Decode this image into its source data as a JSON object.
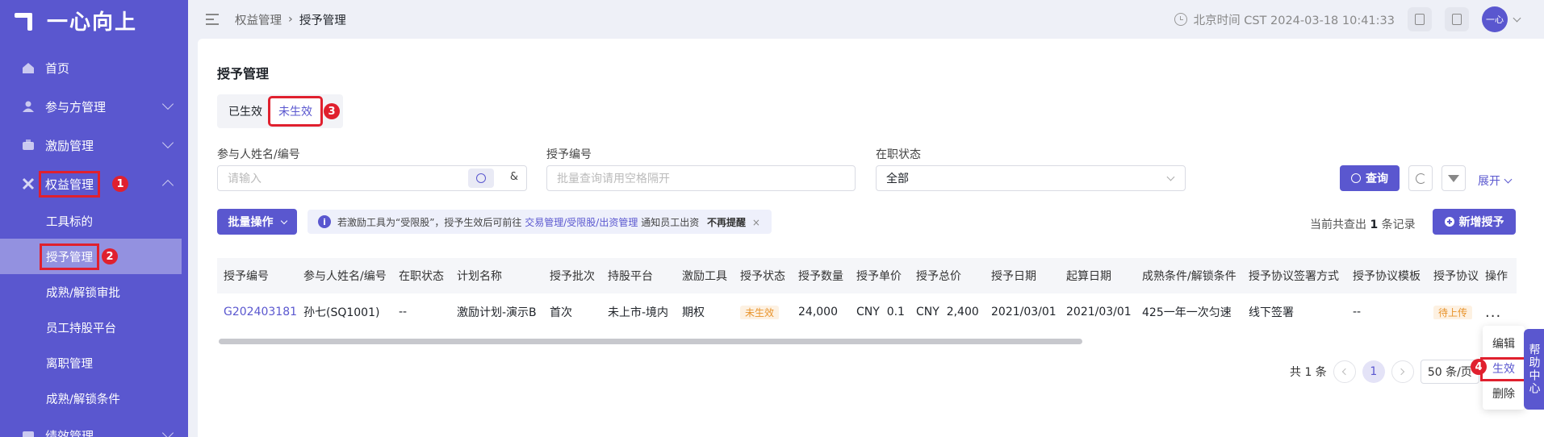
{
  "brand": {
    "name": "一心向上"
  },
  "sidebar": {
    "items": [
      {
        "label": "首页",
        "icon": "home-icon",
        "has_children": false
      },
      {
        "label": "参与方管理",
        "icon": "users-icon",
        "has_children": true
      },
      {
        "label": "激励管理",
        "icon": "incentive-icon",
        "has_children": true
      },
      {
        "label": "权益管理",
        "icon": "equity-icon",
        "has_children": true,
        "expanded": true,
        "badge": "1"
      },
      {
        "label": "绩效管理",
        "icon": "performance-icon",
        "has_children": true
      }
    ],
    "sub_items": [
      {
        "label": "工具标的"
      },
      {
        "label": "授予管理",
        "active": true,
        "badge": "2"
      },
      {
        "label": "成熟/解锁审批"
      },
      {
        "label": "员工持股平台"
      },
      {
        "label": "离职管理"
      },
      {
        "label": "成熟/解锁条件"
      }
    ]
  },
  "header": {
    "breadcrumb": [
      "权益管理",
      "授予管理"
    ],
    "time_text": "北京时间 CST 2024-03-18 10:41:33",
    "avatar_text": "一心"
  },
  "page": {
    "title": "授予管理",
    "tabs": [
      {
        "label": "已生效",
        "active": false
      },
      {
        "label": "未生效",
        "active": true,
        "badge": "3"
      }
    ]
  },
  "filters": {
    "participant": {
      "label": "参与人姓名/编号",
      "placeholder": "请输入"
    },
    "grant_no": {
      "label": "授予编号",
      "placeholder": "批量查询请用空格隔开"
    },
    "employment": {
      "label": "在职状态",
      "value": "全部"
    },
    "query_label": "查询",
    "expand_label": "展开"
  },
  "toolbar": {
    "batch_label": "批量操作",
    "notice_prefix": "若激励工具为“受限股”，授予生效后可前往",
    "notice_link": "交易管理/受限股/出资管理",
    "notice_suffix": "通知员工出资",
    "notice_dismiss": "不再提醒",
    "count_prefix": "当前共查出",
    "count_value": "1",
    "count_suffix": "条记录",
    "add_label": "新增授予"
  },
  "table": {
    "columns": [
      "授予编号",
      "参与人姓名/编号",
      "在职状态",
      "计划名称",
      "授予批次",
      "持股平台",
      "激励工具",
      "授予状态",
      "授予数量",
      "授予单价",
      "授予总价",
      "授予日期",
      "起算日期",
      "成熟条件/解锁条件",
      "授予协议签署方式",
      "授予协议模板",
      "授予协议",
      "操作"
    ],
    "rows": [
      [
        "G202403181",
        "孙七(SQ1001)",
        "--",
        "激励计划-演示B",
        "首次",
        "未上市-境内",
        "期权",
        "未生效",
        "24,000",
        "CNY  0.1",
        "CNY  2,400",
        "2021/03/01",
        "2021/03/01",
        "425一年一次匀速",
        "线下签署",
        "--",
        "待上传",
        "..."
      ]
    ]
  },
  "pagination": {
    "total_text": "共 1 条",
    "current_page": "1",
    "page_size_text": "50 条/页"
  },
  "row_menu": {
    "items": [
      "编辑",
      "生效",
      "删除"
    ],
    "highlighted": "生效",
    "badge": "4"
  },
  "help_tab": {
    "label": "帮助中心"
  },
  "colors": {
    "primary": "#5a57cf",
    "annotation_red": "#e0202e",
    "pending_orange": "#e8932b"
  }
}
